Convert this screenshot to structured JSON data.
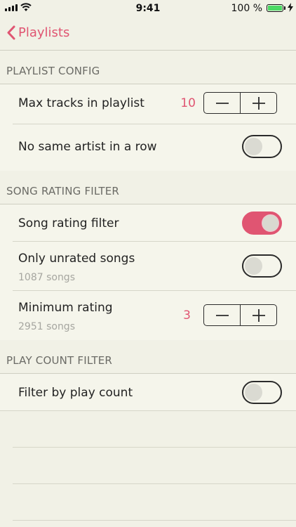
{
  "status_bar": {
    "time": "9:41",
    "battery_text": "100 %",
    "battery_level": 1.0
  },
  "nav": {
    "back_label": "Playlists"
  },
  "sections": {
    "playlist_config": {
      "header": "PLAYLIST CONFIG",
      "max_tracks": {
        "label": "Max tracks in playlist",
        "value": "10"
      },
      "no_same_artist": {
        "label": "No same artist in a row",
        "enabled": false
      }
    },
    "song_rating": {
      "header": "SONG RATING FILTER",
      "song_rating_filter": {
        "label": "Song rating filter",
        "enabled": true
      },
      "only_unrated": {
        "label": "Only unrated songs",
        "subtitle": "1087 songs",
        "enabled": false
      },
      "minimum_rating": {
        "label": "Minimum rating",
        "subtitle": "2951 songs",
        "value": "3"
      }
    },
    "play_count": {
      "header": "PLAY COUNT FILTER",
      "filter_by_play_count": {
        "label": "Filter by play count",
        "enabled": false
      }
    }
  },
  "colors": {
    "accent": "#e05572",
    "background": "#f1f1e6",
    "row_background": "#f5f5eb",
    "secondary_text": "#a6a6a0"
  },
  "icons": [
    "signal-icon",
    "wifi-icon",
    "battery-icon",
    "charging-bolt-icon",
    "back-chevron-icon",
    "minus-icon",
    "plus-icon"
  ]
}
